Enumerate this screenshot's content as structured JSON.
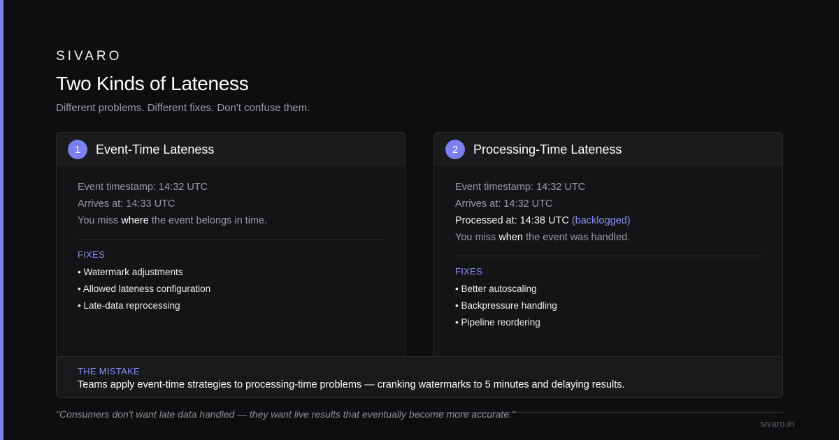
{
  "brand": "SIVARO",
  "title": "Two Kinds of Lateness",
  "subtitle": "Different problems. Different fixes. Don't confuse them.",
  "colors": {
    "accent": "#7c7ff2",
    "background": "#0e0e10",
    "card": "#141416"
  },
  "cards": [
    {
      "number": "1",
      "title": "Event-Time Lateness",
      "event_timestamp": "Event timestamp: 14:32 UTC",
      "arrives": "Arrives at: 14:33 UTC",
      "miss_pre": "You miss ",
      "miss_key": "where",
      "miss_post": " the event belongs in time.",
      "fixes_label": "FIXES",
      "fixes": [
        "• Watermark adjustments",
        "• Allowed lateness configuration",
        "• Late-data reprocessing"
      ]
    },
    {
      "number": "2",
      "title": "Processing-Time Lateness",
      "event_timestamp": "Event timestamp: 14:32 UTC",
      "arrives": "Arrives at: 14:32 UTC",
      "processed": "Processed at: 14:38 UTC",
      "processed_tag": "(backlogged)",
      "miss_pre": "You miss ",
      "miss_key": "when",
      "miss_post": " the event was handled.",
      "fixes_label": "FIXES",
      "fixes": [
        "• Better autoscaling",
        "• Backpressure handling",
        "• Pipeline reordering"
      ]
    }
  ],
  "mistake": {
    "label": "THE MISTAKE",
    "text": "Teams apply event-time strategies to processing-time problems — cranking watermarks to 5 minutes and delaying results."
  },
  "quote": "\"Consumers don't want late data handled — they want live results that eventually become more accurate.\"",
  "site": "sivaro.in"
}
